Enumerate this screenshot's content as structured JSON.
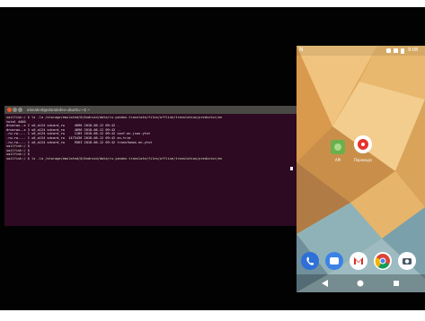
{
  "terminal": {
    "title": "olanaknd@olanakdev-ubuntu:~$ ~",
    "lines": [
      "sailfish:/ $ ls -la /storage/emulated/0/Android/data/ru.yandex.translate/files/offline/translation/predictor/en",
      "total 4400",
      "drwxrwx--x 2 u0_a124 sdcard_rw     4096 2018-06-12 09:42 .",
      "drwxrwx--x 3 u0_a124 sdcard_rw     4096 2018-06-12 09:42 ..",
      "-rw-rw---- 1 u0_a124 sdcard_rw     1105 2018-06-12 09:42 conf.en.json.ytxt",
      "-rw-rw---- 1 u0_a124 sdcard_rw  1475436 2018-06-12 09:42 en.trie",
      "-rw-rw---- 1 u0_a124 sdcard_rw     9563 2018-06-12 09:42 transfomos.en.ytxt",
      "sailfish:/ $",
      "sailfish:/ $",
      "sailfish:/ $",
      "sailfish:/ $ ls -la /storage/emulated/0/Android/data/ru.yandex.translate/files/offline/translation/predictor/en"
    ]
  },
  "phone": {
    "status_left": "N",
    "status_time": "9:08",
    "home_apps": [
      {
        "label": "API",
        "icon": "android-icon",
        "color": "#6ab04c"
      },
      {
        "label": "Переводч",
        "icon": "translate-icon",
        "color": "#ffffff"
      }
    ],
    "dock_apps": [
      {
        "icon": "phone-icon",
        "color": "#2e6fd8"
      },
      {
        "icon": "messages-icon",
        "color": "#3b82e6"
      },
      {
        "icon": "gmail-icon",
        "color": "#ffffff"
      },
      {
        "icon": "chrome-icon",
        "color": "#ffffff"
      },
      {
        "icon": "camera-icon",
        "color": "#ffffff"
      }
    ]
  },
  "colors": {
    "terminal_bg": "#2d0922",
    "titlebar": "#4a4844",
    "close_button": "#e65a2c",
    "wallpaper_light": "#f2c783",
    "wallpaper_mid": "#d99a4e",
    "wallpaper_blue": "#8fb2b9"
  }
}
